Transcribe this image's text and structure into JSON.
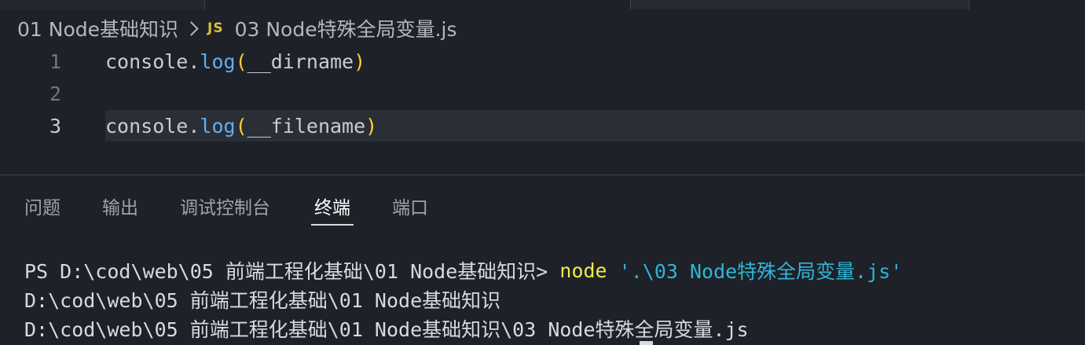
{
  "breadcrumb": {
    "folder": "01 Node基础知识",
    "file_icon": "JS",
    "file": "03 Node特殊全局变量.js"
  },
  "editor": {
    "lines": [
      {
        "number": "1",
        "obj": "console",
        "dot": ".",
        "fn": "log",
        "open": "(",
        "arg": "__dirname",
        "close": ")"
      },
      {
        "number": "2"
      },
      {
        "number": "3",
        "obj": "console",
        "dot": ".",
        "fn": "log",
        "open": "(",
        "arg": "__filename",
        "close": ")"
      }
    ]
  },
  "panel": {
    "tabs": [
      "问题",
      "输出",
      "调试控制台",
      "终端",
      "端口"
    ],
    "active_tab": "终端"
  },
  "terminal": {
    "prompt": "PS D:\\cod\\web\\05 前端工程化基础\\01 Node基础知识> ",
    "command": "node",
    "argument": " '.\\03 Node特殊全局变量.js'",
    "output": [
      "D:\\cod\\web\\05 前端工程化基础\\01 Node基础知识",
      "D:\\cod\\web\\05 前端工程化基础\\01 Node基础知识\\03 Node特殊全局变量.js"
    ]
  },
  "colors": {
    "background": "#1e2128",
    "function": "#61afef",
    "bracket": "#f2d339",
    "terminal_command": "#f2e84b",
    "terminal_string": "#2fb5d5",
    "js_icon": "#d9c13b"
  }
}
